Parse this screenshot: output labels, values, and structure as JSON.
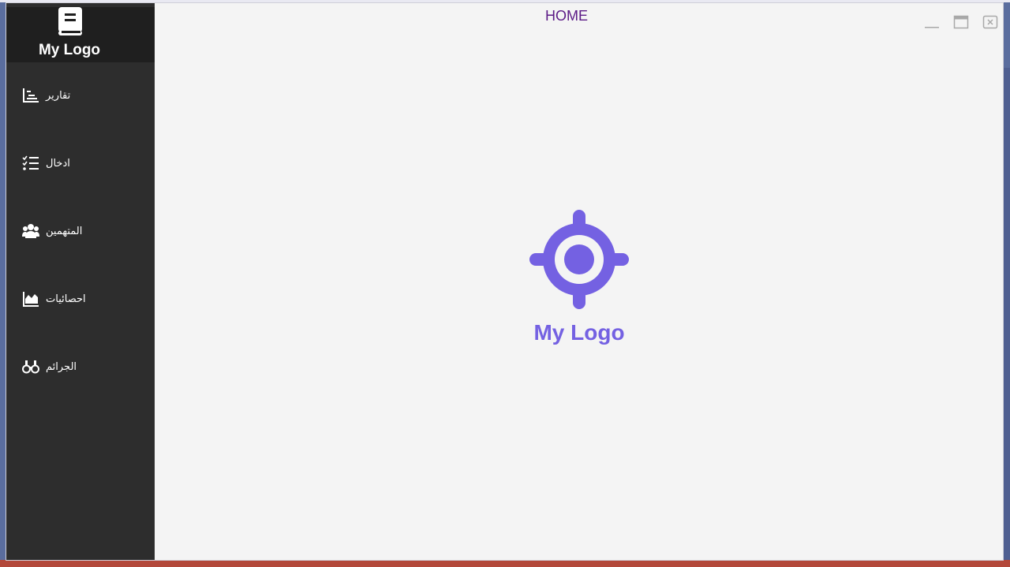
{
  "window": {
    "title": "HOME"
  },
  "sidebar": {
    "logo_text": "My Logo",
    "items": [
      {
        "label": "تقارير",
        "icon": "chart-report-icon"
      },
      {
        "label": "ادخال",
        "icon": "checklist-icon"
      },
      {
        "label": "المتهمين",
        "icon": "users-icon"
      },
      {
        "label": "احصائيات",
        "icon": "area-chart-icon"
      },
      {
        "label": "الجرائم",
        "icon": "binoculars-icon"
      }
    ]
  },
  "main": {
    "logo_text": "My Logo",
    "logo_icon": "crosshair-target-icon"
  },
  "colors": {
    "sidebar_bg": "#2d2d2d",
    "sidebar_header_bg": "#1f1f1f",
    "main_bg": "#f4f4f4",
    "accent_purple": "#7461e2",
    "title_color": "#5b1a86"
  }
}
